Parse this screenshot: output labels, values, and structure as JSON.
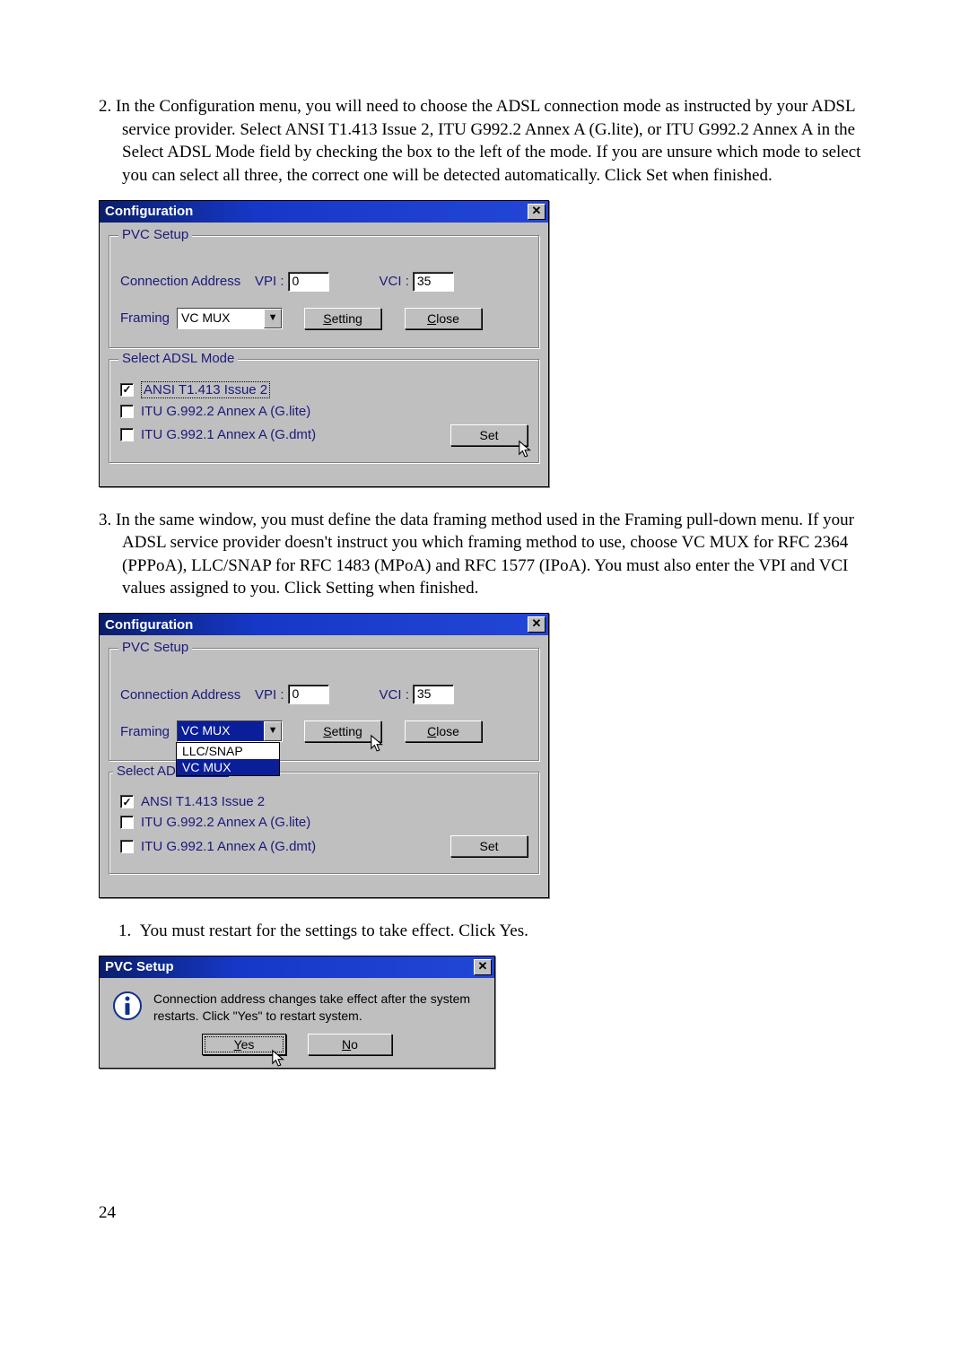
{
  "step2": {
    "num": "2.",
    "text": "In the Configuration menu, you will need to choose the ADSL connection mode as instructed by your ADSL service provider. Select ANSI T1.413 Issue 2, ITU G992.2 Annex A (G.lite), or ITU G992.2 Annex A in the Select ADSL Mode field by checking the box to the left of the mode. If you are unsure which mode to select you can select all three, the correct one will be detected automatically.  Click Set when finished."
  },
  "dialog1": {
    "title": "Configuration",
    "pvc": {
      "legend": "PVC Setup",
      "conn_label": "Connection Address",
      "vpi_label": "VPI :",
      "vpi_value": "0",
      "vci_label": "VCI :",
      "vci_value": "35",
      "framing_label": "Framing",
      "framing_value": "VC MUX",
      "setting_btn_pre": "S",
      "setting_btn_rest": "etting",
      "close_btn_pre": "C",
      "close_btn_rest": "lose"
    },
    "mode": {
      "legend": "Select ADSL Mode",
      "opt1": "ANSI T1.413 Issue 2",
      "opt2": "ITU G.992.2 Annex A (G.lite)",
      "opt3": "ITU G.992.1 Annex A (G.dmt)",
      "set_btn": "Set"
    }
  },
  "step3": {
    "num": "3.",
    "text": "In the same window, you must define the data framing method used in the Framing pull-down menu. If your ADSL service provider doesn't instruct you which framing method to use, choose VC MUX for RFC 2364 (PPPoA), LLC/SNAP for RFC 1483 (MPoA) and RFC 1577 (IPoA). You must also enter the VPI and VCI values assigned to you. Click Setting when finished."
  },
  "dialog2": {
    "dropdown": {
      "opt1": "LLC/SNAP",
      "opt2": "VC MUX"
    }
  },
  "step1r": {
    "num": "1.",
    "text": "You must restart for the settings to take effect. Click Yes."
  },
  "msgbox": {
    "title": "PVC Setup",
    "body": "Connection address changes take effect after the system restarts. Click \"Yes\" to restart system.",
    "yes_pre": "Y",
    "yes_rest": "es",
    "no_pre": "N",
    "no_rest": "o"
  },
  "page_number": "24"
}
